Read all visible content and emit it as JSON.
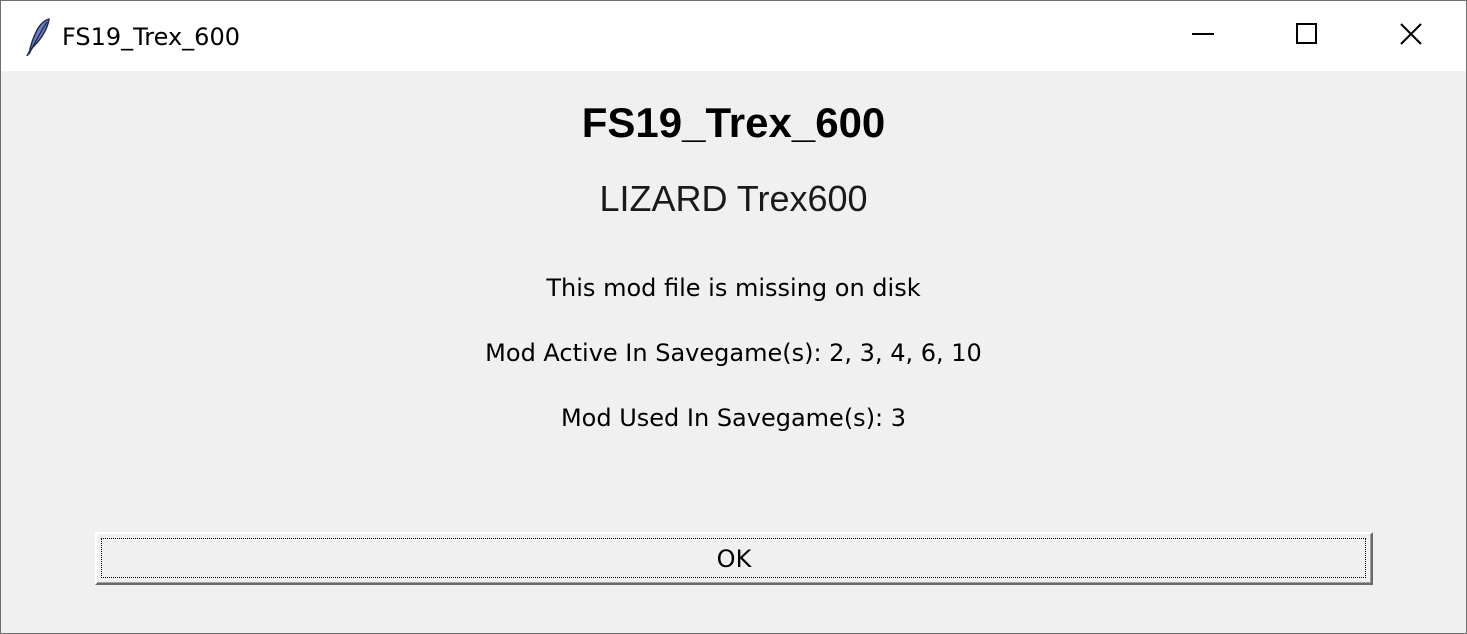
{
  "window": {
    "title": "FS19_Trex_600",
    "icon": "feather-icon",
    "controls": [
      "minimize-icon",
      "maximize-icon",
      "close-icon"
    ]
  },
  "dialog": {
    "mod_title": "FS19_Trex_600",
    "mod_name": "LIZARD Trex600",
    "missing_text": "This mod file is missing on disk",
    "active_text": "Mod Active In Savegame(s): 2, 3, 4, 6, 10",
    "used_text": "Mod Used In Savegame(s): 3",
    "ok_label": "OK"
  },
  "colors": {
    "background": "#f0f0f0",
    "titlebar": "#ffffff",
    "text": "#000000"
  }
}
